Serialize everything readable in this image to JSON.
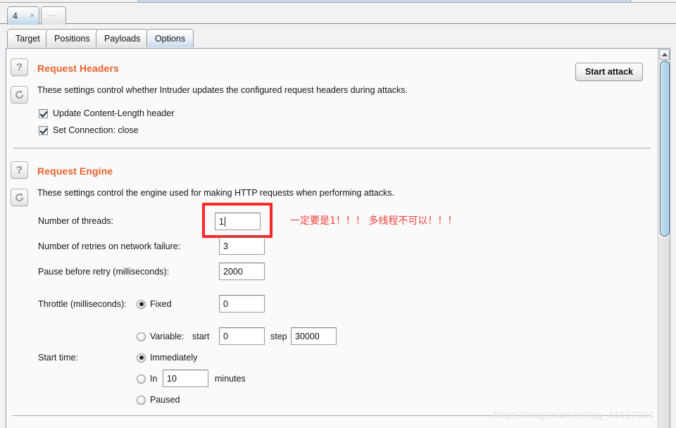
{
  "window": {
    "attack_tabs": [
      {
        "label": "4",
        "close_icon": "close-x-icon",
        "active": true
      },
      {
        "label": "...",
        "active": false
      }
    ],
    "sub_tabs": [
      {
        "label": "Target",
        "active": false
      },
      {
        "label": "Positions",
        "active": false
      },
      {
        "label": "Payloads",
        "active": false
      },
      {
        "label": "Options",
        "active": true
      }
    ]
  },
  "toolbar": {
    "start_attack_label": "Start attack"
  },
  "sections": {
    "request_headers": {
      "title": "Request Headers",
      "help_icon": "question-mark-icon",
      "reset_icon": "refresh-arrow-icon",
      "description": "These settings control whether Intruder updates the configured request headers during attacks.",
      "checkboxes": [
        {
          "label": "Update Content-Length header",
          "checked": true
        },
        {
          "label": "Set Connection: close",
          "checked": true
        }
      ]
    },
    "request_engine": {
      "title": "Request Engine",
      "help_icon": "question-mark-icon",
      "reset_icon": "refresh-arrow-icon",
      "description": "These settings control the engine used for making HTTP requests when performing attacks.",
      "fields": {
        "threads": {
          "label": "Number of threads:",
          "value": "1",
          "focused": true,
          "highlighted": true
        },
        "retries": {
          "label": "Number of retries on network failure:",
          "value": "3"
        },
        "pause": {
          "label": "Pause before retry (milliseconds):",
          "value": "2000"
        }
      },
      "throttle": {
        "label": "Throttle (milliseconds):",
        "fixed": {
          "label": "Fixed",
          "selected": true,
          "value": "0"
        },
        "variable": {
          "label": "Variable:",
          "selected": false,
          "start_label": "start",
          "start_value": "0",
          "step_label": "step",
          "step_value": "30000"
        }
      },
      "start_time": {
        "label": "Start time:",
        "options": [
          {
            "label": "Immediately",
            "selected": true
          },
          {
            "label": "In",
            "selected": false,
            "value": "10",
            "suffix": "minutes"
          },
          {
            "label": "Paused",
            "selected": false
          }
        ]
      }
    }
  },
  "annotations": {
    "threads_note": "一定要是1！！！ 多线程不可以！！！",
    "threads_note_color": "#f1403a"
  },
  "watermark": {
    "text": "https://blog.csdn.net/qq_41617034"
  },
  "scrollbar": {
    "up_arrow_icon": "triangle-up-icon"
  }
}
